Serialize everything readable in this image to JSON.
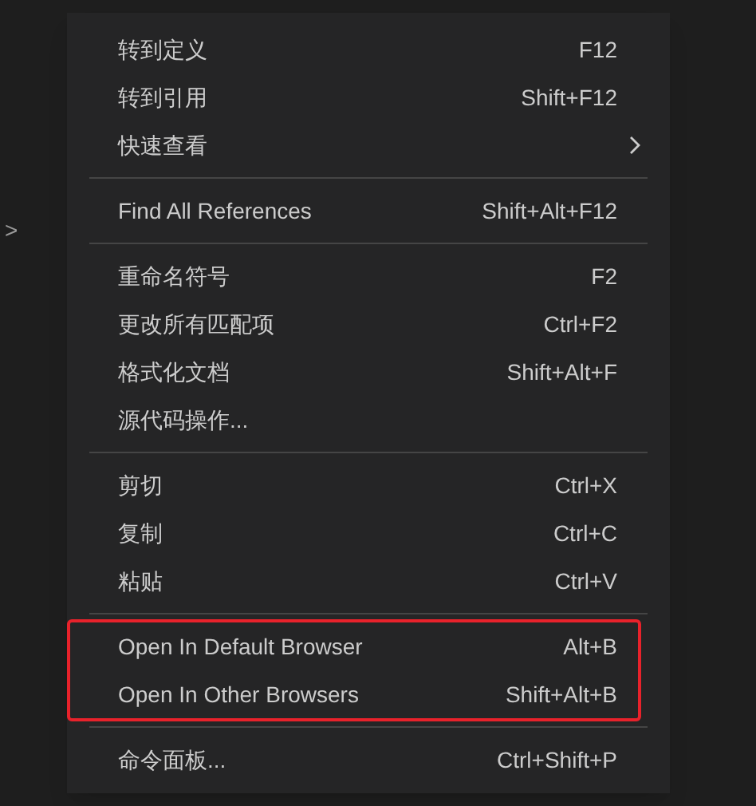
{
  "gutter_mark": ">",
  "menu": {
    "groups": [
      {
        "highlighted": false,
        "items": [
          {
            "label": "转到定义",
            "shortcut": "F12"
          },
          {
            "label": "转到引用",
            "shortcut": "Shift+F12"
          },
          {
            "label": "快速查看",
            "submenu": true
          }
        ]
      },
      {
        "highlighted": false,
        "items": [
          {
            "label": "Find All References",
            "shortcut": "Shift+Alt+F12"
          }
        ]
      },
      {
        "highlighted": false,
        "items": [
          {
            "label": "重命名符号",
            "shortcut": "F2"
          },
          {
            "label": "更改所有匹配项",
            "shortcut": "Ctrl+F2"
          },
          {
            "label": "格式化文档",
            "shortcut": "Shift+Alt+F"
          },
          {
            "label": "源代码操作..."
          }
        ]
      },
      {
        "highlighted": false,
        "items": [
          {
            "label": "剪切",
            "shortcut": "Ctrl+X"
          },
          {
            "label": "复制",
            "shortcut": "Ctrl+C"
          },
          {
            "label": "粘贴",
            "shortcut": "Ctrl+V"
          }
        ]
      },
      {
        "highlighted": true,
        "items": [
          {
            "label": "Open In Default Browser",
            "shortcut": "Alt+B"
          },
          {
            "label": "Open In Other Browsers",
            "shortcut": "Shift+Alt+B"
          }
        ]
      },
      {
        "highlighted": false,
        "items": [
          {
            "label": "命令面板...",
            "shortcut": "Ctrl+Shift+P"
          }
        ]
      }
    ]
  }
}
